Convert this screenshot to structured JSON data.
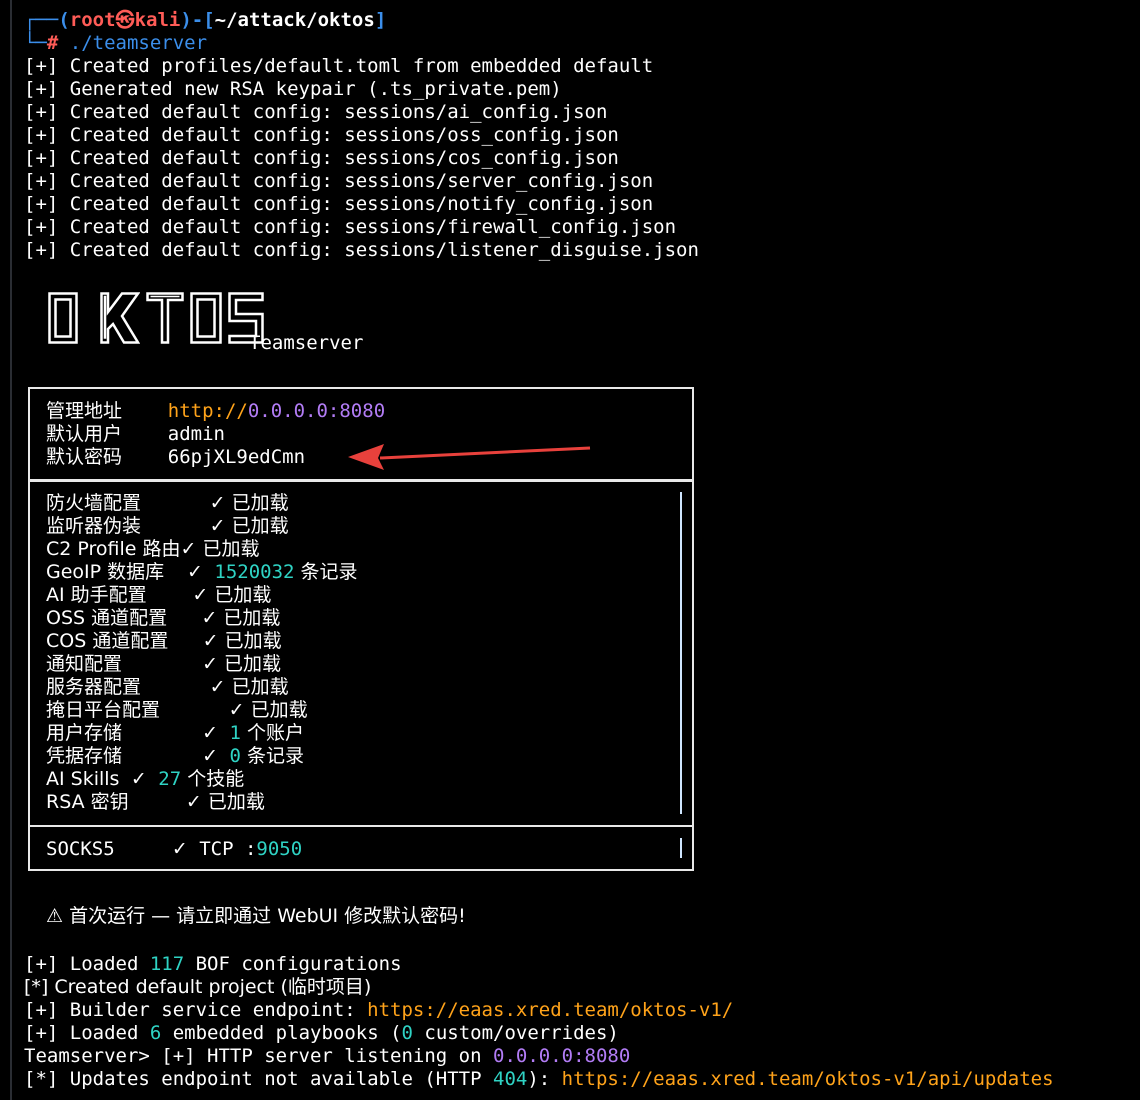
{
  "prompt": {
    "corner_top": "┌──",
    "open_paren": "(",
    "user": "root",
    "skull": "㉿",
    "host": "kali",
    "close_sep": ")-[",
    "path": "~/attack/oktos",
    "close_bracket": "]",
    "corner_bottom": "└─",
    "hash": "#",
    "command": " ./teamserver"
  },
  "startup_log": [
    "[+] Created profiles/default.toml from embedded default",
    "[+] Generated new RSA keypair (.ts_private.pem)",
    "[+] Created default config: sessions/ai_config.json",
    "[+] Created default config: sessions/oss_config.json",
    "[+] Created default config: sessions/cos_config.json",
    "[+] Created default config: sessions/server_config.json",
    "[+] Created default config: sessions/notify_config.json",
    "[+] Created default config: sessions/firewall_config.json",
    "[+] Created default config: sessions/listener_disguise.json"
  ],
  "logo": {
    "letters": "OKTOS",
    "subtitle": "Teamserver"
  },
  "info_box": {
    "admin_label": "管理地址",
    "admin_scheme": "http://",
    "admin_host": "0.0.0.0:8080",
    "user_label": "默认用户",
    "user_value": "admin",
    "pass_label": "默认密码",
    "pass_value": "66pjXL9edCmn"
  },
  "status_rows": [
    {
      "label": "防火墙配置",
      "pad": "      ",
      "check": "✓",
      "num": "",
      "text": " 已加载"
    },
    {
      "label": "监听器伪装",
      "pad": "      ",
      "check": "✓",
      "num": "",
      "text": " 已加载"
    },
    {
      "label": "C2 Profile 路由",
      "pad": "",
      "check": "✓",
      "num": "",
      "text": " 已加载"
    },
    {
      "label": "GeoIP 数据库",
      "pad": "  ",
      "check": "✓",
      "num": " 1520032",
      "text": " 条记录"
    },
    {
      "label": "AI 助手配置",
      "pad": "    ",
      "check": "✓",
      "num": "",
      "text": " 已加载"
    },
    {
      "label": "OSS 通道配置",
      "pad": "   ",
      "check": "✓",
      "num": "",
      "text": " 已加载"
    },
    {
      "label": "COS 通道配置",
      "pad": "   ",
      "check": "✓",
      "num": "",
      "text": " 已加载"
    },
    {
      "label": "通知配置",
      "pad": "       ",
      "check": "✓",
      "num": "",
      "text": " 已加载"
    },
    {
      "label": "服务器配置",
      "pad": "      ",
      "check": "✓",
      "num": "",
      "text": " 已加载"
    },
    {
      "label": "掩日平台配置",
      "pad": "      ",
      "check": "✓",
      "num": "",
      "text": " 已加载"
    },
    {
      "label": "用户存储",
      "pad": "       ",
      "check": "✓",
      "num": " 1",
      "text": " 个账户"
    },
    {
      "label": "凭据存储",
      "pad": "       ",
      "check": "✓",
      "num": " 0",
      "text": " 条记录"
    },
    {
      "label": "AI Skills",
      "pad": " ",
      "check": "✓",
      "num": " 27",
      "text": " 个技能"
    },
    {
      "label": "RSA 密钥",
      "pad": "     ",
      "check": "✓",
      "num": "",
      "text": " 已加载"
    }
  ],
  "socks": {
    "label": "SOCKS5",
    "pad": "     ",
    "check": "✓",
    "proto": " TCP :",
    "port": "9050"
  },
  "warning": {
    "icon": "⚠",
    "text": " 首次运行 — 请立即通过 WebUI 修改默认密码!"
  },
  "tail_log": {
    "l1_a": "[+] Loaded ",
    "l1_num": "117",
    "l1_b": " BOF configurations",
    "l2": "[*] Created default project (临时项目)",
    "l3_a": "[+] Builder service endpoint: ",
    "l3_url": "https://eaas.xred.team/oktos-v1/",
    "l4_a": "[+] Loaded ",
    "l4_num": "6",
    "l4_b": " embedded playbooks (",
    "l4_num2": "0",
    "l4_c": " custom/overrides)",
    "l5_a": "Teamserver> [+] HTTP server listening on ",
    "l5_host": "0.0.0.0:8080",
    "l6_a": "[*] Updates endpoint not available (HTTP ",
    "l6_code": "404",
    "l6_b": "): ",
    "l6_url": "https://eaas.xred.team/oktos-v1/api/updates"
  },
  "colors": {
    "background": "#000000",
    "prompt_blue": "#3b8eea",
    "prompt_red": "#ff5c57",
    "number_cyan": "#2fd3c4",
    "host_purple": "#b27cf5",
    "url_orange": "#ffa31a",
    "arrow_red": "#e8413c"
  }
}
